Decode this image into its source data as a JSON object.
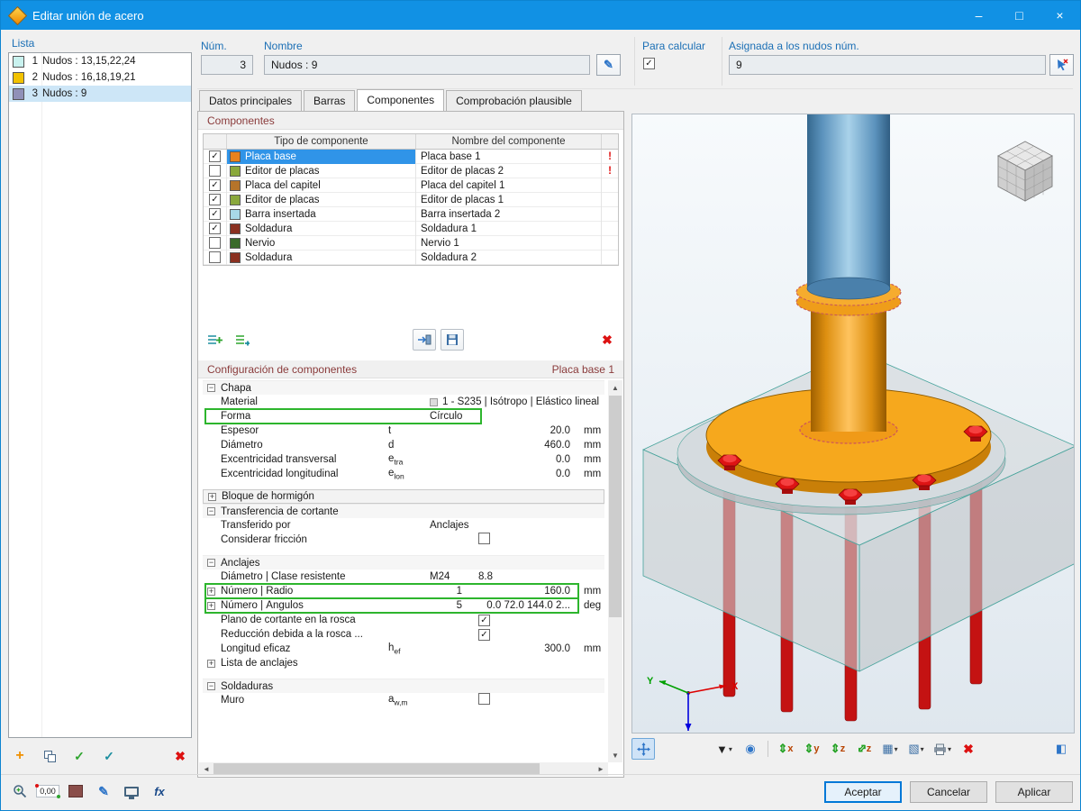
{
  "window": {
    "title": "Editar unión de acero"
  },
  "buttons": {
    "ok": "Aceptar",
    "cancel": "Cancelar",
    "apply": "Aplicar"
  },
  "list_panel": {
    "label": "Lista",
    "items": [
      {
        "num": "1",
        "label": "Nudos : 13,15,22,24",
        "color": "#c9f2ef",
        "selected": false
      },
      {
        "num": "2",
        "label": "Nudos : 16,18,19,21",
        "color": "#f2c200",
        "selected": false
      },
      {
        "num": "3",
        "label": "Nudos : 9",
        "color": "#9090b8",
        "selected": true
      }
    ]
  },
  "header": {
    "num_label": "Núm.",
    "num_value": "3",
    "name_label": "Nombre",
    "name_value": "Nudos : 9",
    "calc_label": "Para calcular",
    "calc_checked": true,
    "assigned_label": "Asignada a los nudos núm.",
    "assigned_value": "9"
  },
  "tabs": [
    {
      "label": "Datos principales",
      "active": false
    },
    {
      "label": "Barras",
      "active": false
    },
    {
      "label": "Componentes",
      "active": true
    },
    {
      "label": "Comprobación plausible",
      "active": false
    }
  ],
  "components": {
    "section_title": "Componentes",
    "columns": {
      "type": "Tipo de componente",
      "name": "Nombre del componente"
    },
    "rows": [
      {
        "checked": true,
        "color": "#e8821e",
        "type": "Placa base",
        "name": "Placa base 1",
        "warning": true,
        "selected": true
      },
      {
        "checked": false,
        "color": "#8aa83c",
        "type": "Editor de placas",
        "name": "Editor de placas 2",
        "warning": true,
        "selected": false
      },
      {
        "checked": true,
        "color": "#b5742a",
        "type": "Placa del capitel",
        "name": "Placa del capitel 1",
        "warning": false,
        "selected": false
      },
      {
        "checked": true,
        "color": "#8aa83c",
        "type": "Editor de placas",
        "name": "Editor de placas 1",
        "warning": false,
        "selected": false
      },
      {
        "checked": true,
        "color": "#a8d8e8",
        "type": "Barra insertada",
        "name": "Barra insertada 2",
        "warning": false,
        "selected": false
      },
      {
        "checked": true,
        "color": "#8a3020",
        "type": "Soldadura",
        "name": "Soldadura 1",
        "warning": false,
        "selected": false
      },
      {
        "checked": false,
        "color": "#3a6a2a",
        "type": "Nervio",
        "name": "Nervio 1",
        "warning": false,
        "selected": false
      },
      {
        "checked": false,
        "color": "#8a3020",
        "type": "Soldadura",
        "name": "Soldadura 2",
        "warning": false,
        "selected": false
      }
    ]
  },
  "config": {
    "section_title": "Configuración de componentes",
    "selected_component": "Placa base 1",
    "rows": [
      {
        "kind": "group",
        "label": "Chapa",
        "expander": "minus"
      },
      {
        "kind": "item",
        "label": "Material",
        "free": "1 - S235 | Isótropo | Elástico lineal",
        "swatch": true
      },
      {
        "kind": "item",
        "label": "Forma",
        "mid": "Círculo",
        "highlight": "short"
      },
      {
        "kind": "item",
        "label": "Espesor",
        "sym": "t",
        "value": "20.0",
        "unit": "mm"
      },
      {
        "kind": "item",
        "label": "Diámetro",
        "sym": "d",
        "value": "460.0",
        "unit": "mm"
      },
      {
        "kind": "item",
        "label": "Excentricidad transversal",
        "sym": "e",
        "sub": "tra",
        "value": "0.0",
        "unit": "mm"
      },
      {
        "kind": "item",
        "label": "Excentricidad longitudinal",
        "sym": "e",
        "sub": "lon",
        "value": "0.0",
        "unit": "mm"
      },
      {
        "kind": "spacer"
      },
      {
        "kind": "group",
        "label": "Bloque de hormigón",
        "expander": "plus",
        "boxed": true
      },
      {
        "kind": "group",
        "label": "Transferencia de cortante",
        "expander": "minus"
      },
      {
        "kind": "item",
        "label": "Transferido por",
        "mid": "Anclajes"
      },
      {
        "kind": "item",
        "label": "Considerar fricción",
        "checkbox": false
      },
      {
        "kind": "spacer"
      },
      {
        "kind": "group",
        "label": "Anclajes",
        "expander": "minus"
      },
      {
        "kind": "item",
        "label": "Diámetro | Clase resistente",
        "mid": "M24",
        "vleft": "8.8"
      },
      {
        "kind": "item",
        "label": "Número | Radio",
        "expander": "plus",
        "midr": "1",
        "value": "160.0",
        "unit": "mm",
        "highlight": "full"
      },
      {
        "kind": "item",
        "label": "Número | Ángulos",
        "expander": "plus",
        "midr": "5",
        "value": "0.0 72.0 144.0 2...",
        "unit": "deg",
        "highlight": "full"
      },
      {
        "kind": "item",
        "label": "Plano de cortante en la rosca",
        "checkbox": true
      },
      {
        "kind": "item",
        "label": "Reducción debida a la rosca ...",
        "checkbox": true
      },
      {
        "kind": "item",
        "label": "Longitud eficaz",
        "sym": "h",
        "sub": "ef",
        "value": "300.0",
        "unit": "mm"
      },
      {
        "kind": "item",
        "label": "Lista de anclajes",
        "expander": "plus"
      },
      {
        "kind": "spacer"
      },
      {
        "kind": "group",
        "label": "Soldaduras",
        "expander": "minus"
      },
      {
        "kind": "item",
        "label": "Muro",
        "sym": "a",
        "sub": "w,m",
        "checkbox": false
      }
    ]
  },
  "viewport": {
    "axis_x": "X",
    "axis_y": "Y",
    "axis_z": "Z"
  },
  "toolbar_bottom": {
    "units_value": "0,00",
    "fx_label": "fx"
  },
  "icons": {
    "app-icon": "orange-diamond-joint",
    "minimize-icon": "–",
    "maximize-icon": "□",
    "close-icon": "×",
    "edit-icon": "✎",
    "pick-nodes-icon": "cursor-arrow-x",
    "new-item-icon": "+",
    "copy-item-icon": "two-squares",
    "check-icon": "✓",
    "check-all-icon": "✓",
    "delete-icon": "✖",
    "insert-row-icon": "list-plus-teal",
    "insert-sub-icon": "list-plus-green",
    "import-icon": "arrow-into-disk",
    "save-icon": "disk-pencil",
    "zoom-icon": "magnifier",
    "display-icon": "monitor",
    "move-view-icon": "✚",
    "insert-node-icon": "▼",
    "photo-icon": "◉",
    "view-x-icon": "⇕x",
    "view-y-icon": "⇕y",
    "view-z-icon": "⇕z",
    "view-iso-icon": "⇕z",
    "display-props-icon": "▦",
    "clip-box-icon": "▧",
    "print-icon": "printer",
    "clear-icon": "✖",
    "panel-icon": "◧",
    "scroll-up-icon": "▲",
    "scroll-down-icon": "▼",
    "scroll-left-icon": "◄",
    "scroll-right-icon": "►"
  },
  "colors": {
    "titlebar": "#1191e4",
    "selection": "#3094e8",
    "highlight_green": "#2db52d",
    "warning_red": "#e01010",
    "label_blue": "#1b6fb5",
    "caption_maroon": "#8a3b3b"
  }
}
